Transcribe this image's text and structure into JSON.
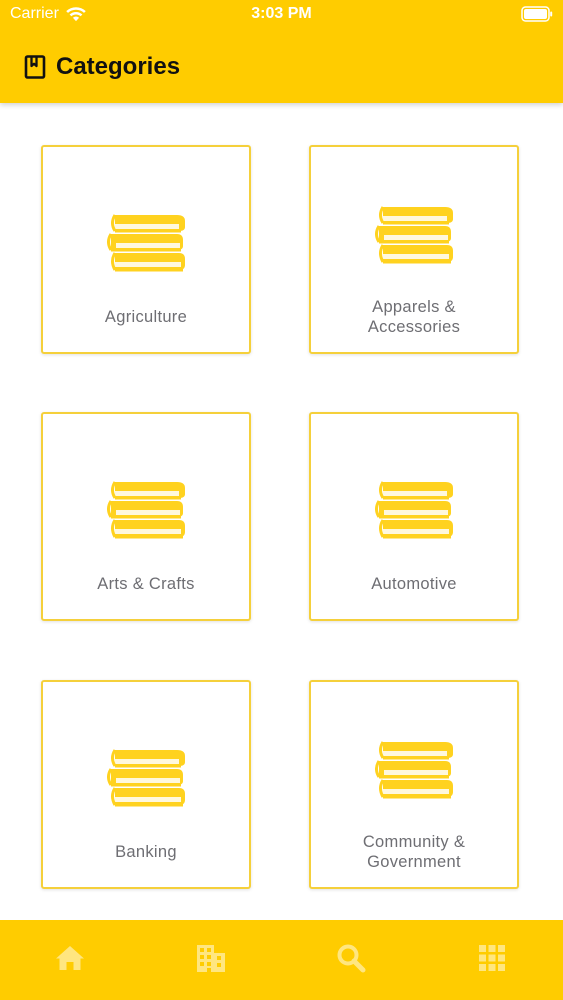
{
  "status_bar": {
    "carrier": "Carrier",
    "time": "3:03 PM",
    "wifi_icon": "wifi-icon",
    "battery_icon": "battery-icon"
  },
  "header": {
    "title": "Categories",
    "icon": "bookmark-book-icon"
  },
  "categories": [
    {
      "label": "Agriculture",
      "icon": "books-icon"
    },
    {
      "label": "Apparels &\nAccessories",
      "icon": "books-icon"
    },
    {
      "label": "Arts & Crafts",
      "icon": "books-icon"
    },
    {
      "label": "Automotive",
      "icon": "books-icon"
    },
    {
      "label": "Banking",
      "icon": "books-icon"
    },
    {
      "label": "Community &\nGovernment",
      "icon": "books-icon"
    }
  ],
  "tabbar": {
    "tabs": [
      {
        "id": "home",
        "icon": "home-icon"
      },
      {
        "id": "business",
        "icon": "building-icon"
      },
      {
        "id": "search",
        "icon": "search-icon"
      },
      {
        "id": "categories",
        "icon": "grid-icon"
      }
    ]
  },
  "colors": {
    "brand_yellow": "#FFCC00",
    "card_border": "#F5D03B",
    "icon_yellow": "#FFD21F",
    "label_gray": "#6E6E73",
    "tab_icon": "#FFE680"
  }
}
